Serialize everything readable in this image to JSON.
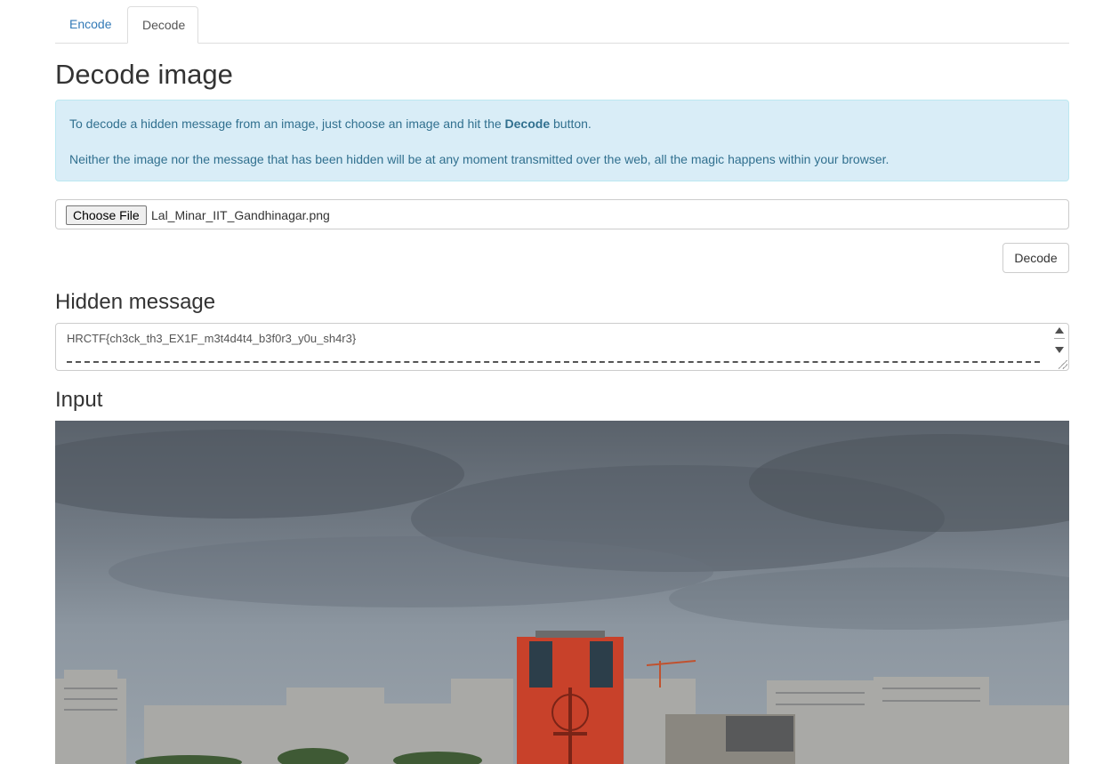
{
  "tabs": [
    {
      "label": "Encode",
      "active": false
    },
    {
      "label": "Decode",
      "active": true
    }
  ],
  "page_title": "Decode image",
  "info": {
    "line1_before": "To decode a hidden message from an image, just choose an image and hit the ",
    "line1_bold": "Decode",
    "line1_after": " button.",
    "line2": "Neither the image nor the message that has been hidden will be at any moment transmitted over the web, all the magic happens within your browser."
  },
  "file_input": {
    "button_label": "Choose File",
    "file_name": "Lal_Minar_IIT_Gandhinagar.png"
  },
  "decode_button": "Decode",
  "hidden_message": {
    "heading": "Hidden message",
    "value": "HRCTF{ch3ck_th3_EX1F_m3t4d4t4_b3f0r3_y0u_sh4r3}"
  },
  "input_section": {
    "heading": "Input"
  },
  "colors": {
    "link": "#337ab7",
    "alert_bg": "#d9edf7",
    "alert_text": "#31708f",
    "tower": "#c8412a"
  },
  "icons": [
    "scroll-up-icon",
    "scroll-down-icon",
    "resize-grip-icon"
  ]
}
